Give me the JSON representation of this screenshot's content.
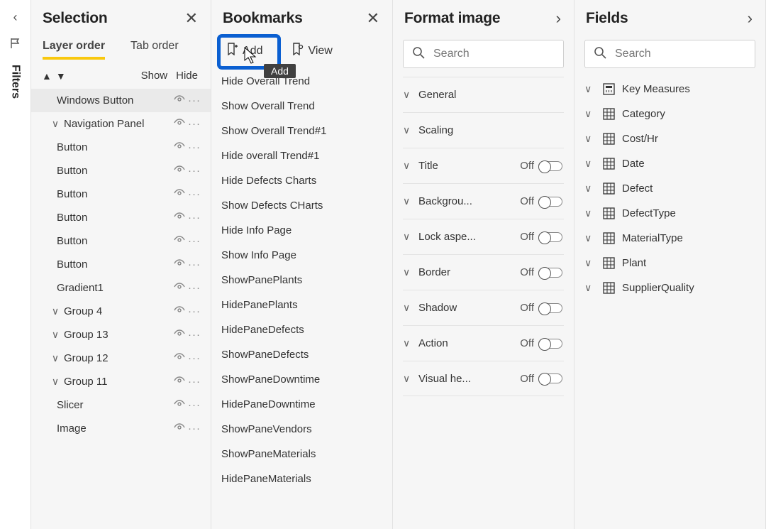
{
  "filters_rail": {
    "label": "Filters"
  },
  "selection_pane": {
    "title": "Selection",
    "tabs": {
      "layer": "Layer order",
      "tab": "Tab order"
    },
    "cols": {
      "show": "Show",
      "hide": "Hide"
    },
    "items": [
      {
        "label": "Windows Button",
        "chev": "",
        "selected": true
      },
      {
        "label": "Navigation Panel",
        "chev": "v",
        "indent": true
      },
      {
        "label": "Button",
        "chev": ""
      },
      {
        "label": "Button",
        "chev": ""
      },
      {
        "label": "Button",
        "chev": ""
      },
      {
        "label": "Button",
        "chev": ""
      },
      {
        "label": "Button",
        "chev": ""
      },
      {
        "label": "Button",
        "chev": ""
      },
      {
        "label": "Gradient1",
        "chev": ""
      },
      {
        "label": "Group 4",
        "chev": "v",
        "indent": true
      },
      {
        "label": "Group 13",
        "chev": "v",
        "indent": true
      },
      {
        "label": "Group 12",
        "chev": "v",
        "indent": true
      },
      {
        "label": "Group 11",
        "chev": "v",
        "indent": true
      },
      {
        "label": "Slicer",
        "chev": ""
      },
      {
        "label": "Image",
        "chev": ""
      }
    ]
  },
  "bookmarks_pane": {
    "title": "Bookmarks",
    "add_label": "Add",
    "view_label": "View",
    "tooltip": "Add",
    "items": [
      "Hide Overall Trend",
      "Show Overall Trend",
      "Show Overall Trend#1",
      "Hide overall Trend#1",
      "Hide Defects Charts",
      "Show Defects CHarts",
      "Hide Info Page",
      "Show Info Page",
      "ShowPanePlants",
      "HidePanePlants",
      "HidePaneDefects",
      "ShowPaneDefects",
      "ShowPaneDowntime",
      "HidePaneDowntime",
      "ShowPaneVendors",
      "ShowPaneMaterials",
      "HidePaneMaterials"
    ]
  },
  "format_pane": {
    "title": "Format image",
    "search_placeholder": "Search",
    "off_label": "Off",
    "sections": [
      {
        "label": "General",
        "toggle": false
      },
      {
        "label": "Scaling",
        "toggle": false
      },
      {
        "label": "Title",
        "toggle": true
      },
      {
        "label": "Backgrou...",
        "toggle": true
      },
      {
        "label": "Lock aspe...",
        "toggle": true
      },
      {
        "label": "Border",
        "toggle": true
      },
      {
        "label": "Shadow",
        "toggle": true
      },
      {
        "label": "Action",
        "toggle": true
      },
      {
        "label": "Visual he...",
        "toggle": true
      }
    ]
  },
  "fields_pane": {
    "title": "Fields",
    "search_placeholder": "Search",
    "items": [
      {
        "label": "Key Measures",
        "icon": "measure"
      },
      {
        "label": "Category",
        "icon": "table"
      },
      {
        "label": "Cost/Hr",
        "icon": "table"
      },
      {
        "label": "Date",
        "icon": "table"
      },
      {
        "label": "Defect",
        "icon": "table"
      },
      {
        "label": "DefectType",
        "icon": "table"
      },
      {
        "label": "MaterialType",
        "icon": "table"
      },
      {
        "label": "Plant",
        "icon": "table"
      },
      {
        "label": "SupplierQuality",
        "icon": "table"
      }
    ]
  }
}
